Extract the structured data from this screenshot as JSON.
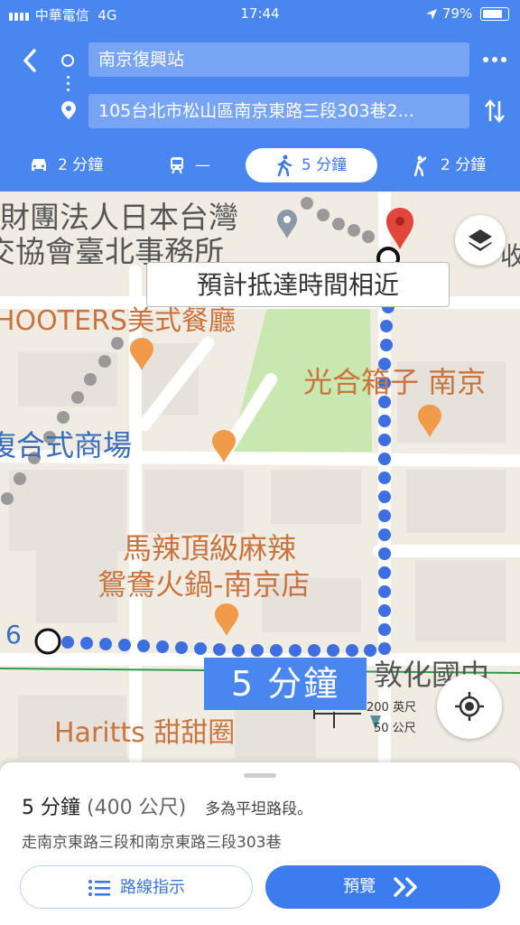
{
  "status_bar": {
    "carrier": "中華電信",
    "network": "4G",
    "time": "17:44",
    "battery": "79%"
  },
  "route": {
    "origin": "南京復興站",
    "destination": "105台北市松山區南京東路三段303巷2..."
  },
  "modes": [
    {
      "icon": "car-icon",
      "label": "2 分鐘"
    },
    {
      "icon": "transit-icon",
      "label": "—"
    },
    {
      "icon": "walk-icon",
      "label": "5 分鐘",
      "selected": true
    },
    {
      "icon": "rideshare-icon",
      "label": "2 分鐘"
    }
  ],
  "map": {
    "labels": {
      "foundation_1": "財團法人日本台灣",
      "foundation_2": "交協會臺北事務所",
      "hooters": "HOOTERS美式餐廳",
      "guanghe": "光合箱子 南京",
      "mall": "復合式商場",
      "mala_1": "馬辣頂級麻辣",
      "mala_2": "鴛鴦火鍋-南京店",
      "haritts": "Haritts 甜甜圈",
      "dunhua": "敦化國中",
      "edge_6": "6",
      "edge_right": "收"
    },
    "eta_note": "預計抵達時間相近",
    "route_time": "5 分鐘",
    "scale": {
      "feet": "200 英尺",
      "meters": "50 公尺"
    }
  },
  "sheet": {
    "time": "5 分鐘",
    "distance": "(400 公尺)",
    "note": "多為平坦路段。",
    "via": "走南京東路三段和南京東路三段303巷",
    "steps_button": "路線指示",
    "preview_button": "預覽"
  },
  "colors": {
    "header": "#4a86f0",
    "route": "#3d6fe0",
    "park": "#c9e8b0",
    "label_orange": "#c9743d",
    "pin_red": "#e2463a"
  }
}
